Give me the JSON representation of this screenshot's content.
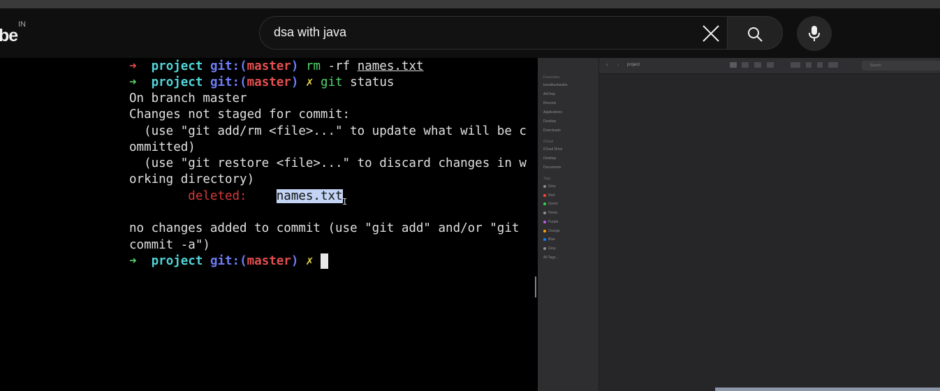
{
  "youtube": {
    "logo_text": "be",
    "region": "IN",
    "search_value": "dsa with java",
    "clear_icon": "close-icon",
    "search_icon": "search-icon",
    "mic_icon": "mic-icon"
  },
  "terminal": {
    "arrow": "➜",
    "dir": "project",
    "git_label": "git:(",
    "branch": "master",
    "git_close": ")",
    "dirty_mark": "✗",
    "cmd1_name": "rm",
    "cmd1_args": " -rf ",
    "cmd1_file": "names.txt",
    "cmd2_name": "git",
    "cmd2_args": " status",
    "output": {
      "l1": "On branch master",
      "l2": "Changes not staged for commit:",
      "l3": "  (use \"git add/rm <file>...\" to update what will be c",
      "l4": "ommitted)",
      "l5": "  (use \"git restore <file>...\" to discard changes in w",
      "l6": "orking directory)",
      "deleted_label": "deleted:",
      "deleted_file": "names.txt",
      "l8": "no changes added to commit (use \"git add\" and/or \"git",
      "l9": "commit -a\")"
    }
  },
  "finder": {
    "title": "project",
    "search_placeholder": "Search",
    "sidebar": {
      "favourites_header": "Favourites",
      "favourites": [
        "kunalkushwaha",
        "AirDrop",
        "Recents",
        "Applications",
        "Desktop",
        "Downloads"
      ],
      "icloud_header": "iCloud",
      "icloud": [
        "iCloud Drive",
        "Desktop",
        "Documents"
      ],
      "tags_header": "Tags",
      "tags": [
        {
          "label": "Grey",
          "color": "#8e8e93"
        },
        {
          "label": "Red",
          "color": "#ff453a"
        },
        {
          "label": "Green",
          "color": "#32d74b"
        },
        {
          "label": "Home",
          "color": "#8e8e93"
        },
        {
          "label": "Purple",
          "color": "#bf5af2"
        },
        {
          "label": "Orange",
          "color": "#ff9f0a"
        },
        {
          "label": "Blue",
          "color": "#0a84ff"
        },
        {
          "label": "Gray",
          "color": "#8e8e93"
        }
      ],
      "all_tags": "All Tags..."
    }
  }
}
